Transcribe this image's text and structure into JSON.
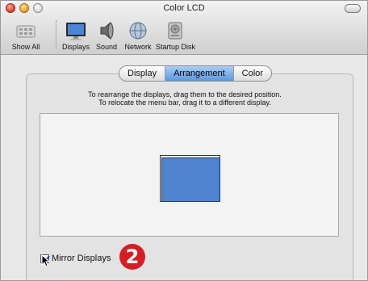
{
  "window": {
    "title": "Color LCD"
  },
  "toolbar": {
    "items": [
      {
        "label": "Show All",
        "icon": "show-all-icon"
      },
      {
        "label": "Displays",
        "icon": "displays-icon"
      },
      {
        "label": "Sound",
        "icon": "sound-icon"
      },
      {
        "label": "Network",
        "icon": "network-icon"
      },
      {
        "label": "Startup Disk",
        "icon": "startup-disk-icon"
      }
    ]
  },
  "tabs": [
    {
      "label": "Display",
      "selected": false
    },
    {
      "label": "Arrangement",
      "selected": true
    },
    {
      "label": "Color",
      "selected": false
    }
  ],
  "instructions": {
    "line1": "To rearrange the displays, drag them to the desired position.",
    "line2": "To relocate the menu bar, drag it to a different display."
  },
  "mirror": {
    "label": "Mirror Displays",
    "checked": true
  },
  "callout": {
    "text": "2",
    "color": "#d21f25"
  },
  "colors": {
    "display_fill": "#4f82cf",
    "tab_selected": "#5a98e2"
  }
}
